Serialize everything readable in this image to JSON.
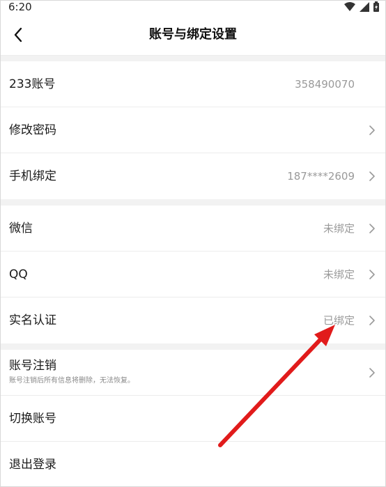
{
  "status_bar": {
    "time": "6:20",
    "icons": [
      "wifi-icon",
      "signal-icon",
      "battery-icon"
    ]
  },
  "nav": {
    "title": "账号与绑定设置",
    "back_icon": "chevron-left-icon"
  },
  "section1": [
    {
      "label": "233账号",
      "value": "358490070",
      "chevron": false
    },
    {
      "label": "修改密码",
      "value": "",
      "chevron": true
    },
    {
      "label": "手机绑定",
      "value": "187****2609",
      "chevron": true
    }
  ],
  "section2": [
    {
      "label": "微信",
      "value": "未绑定",
      "chevron": true
    },
    {
      "label": "QQ",
      "value": "未绑定",
      "chevron": true
    },
    {
      "label": "实名认证",
      "value": "已绑定",
      "chevron": true
    }
  ],
  "section3": {
    "cancel_account": {
      "label": "账号注销",
      "subtitle": "账号注销后所有信息将删除，无法恢复。"
    },
    "switch_account": {
      "label": "切换账号"
    },
    "logout": {
      "label": "退出登录"
    }
  },
  "annotation": {
    "type": "red-arrow",
    "target": "实名认证",
    "color": "#e11b1b"
  }
}
